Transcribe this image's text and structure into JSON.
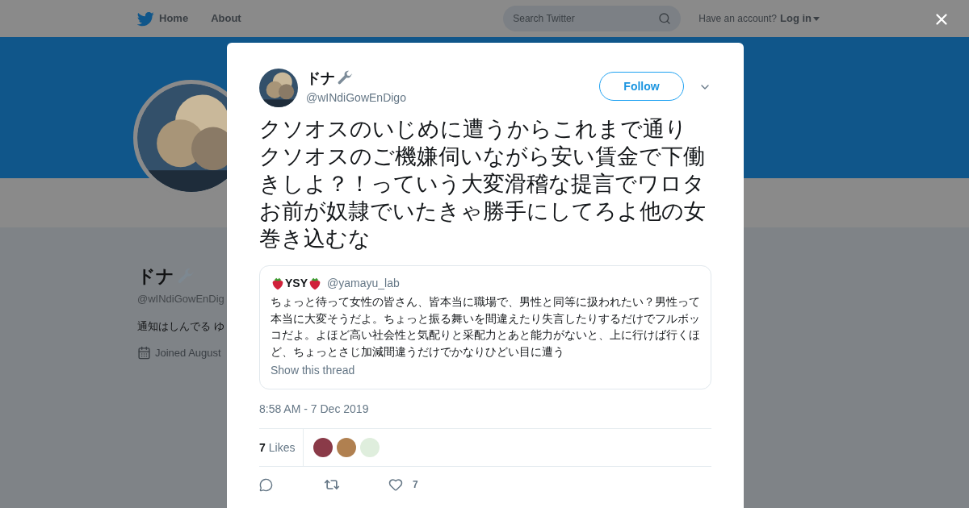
{
  "header": {
    "nav": [
      {
        "label": "Home"
      },
      {
        "label": "About"
      }
    ],
    "search": {
      "placeholder": "Search Twitter"
    },
    "account_prompt": "Have an account?",
    "login": "Log in"
  },
  "profile": {
    "name": "ドナ",
    "handle": "@wINdiGowEnDig",
    "bio": "通知はしんでる ゆ",
    "joined": "Joined August"
  },
  "tweet": {
    "author": {
      "name": "ドナ",
      "handle": "@wINdiGowEnDigo"
    },
    "follow": "Follow",
    "paragraphs": [
      "クソオスのいじめに遭うからこれまで通り",
      "クソオスのご機嫌伺いながら安い賃金で下働きしよ？！っていう大変滑稽な提言でワロタ",
      "お前が奴隷でいたきゃ勝手にしてろよ他の女巻き込むな"
    ],
    "quote": {
      "name": "YSY",
      "handle": "@yamayu_lab",
      "text": "ちょっと待って女性の皆さん、皆本当に職場で、男性と同等に扱われたい？男性って本当に大変そうだよ。ちょっと振る舞いを間違えたり失言したりするだけでフルボッコだよ。よほど高い社会性と気配りと采配力とあと能力がないと、上に行けば行くほど、ちょっとさじ加減間違うだけでかなりひどい目に遭う",
      "link": "Show this thread"
    },
    "timestamp": "8:58 AM - 7 Dec 2019",
    "likes_count": "7",
    "likes_label": "Likes",
    "likers": [
      {
        "color": "#8a3a48"
      },
      {
        "color": "#b08050"
      },
      {
        "color": "#dfeedd"
      }
    ],
    "actions": [
      {
        "kind": "reply"
      },
      {
        "kind": "retweet"
      },
      {
        "kind": "like",
        "count": "7"
      }
    ]
  }
}
